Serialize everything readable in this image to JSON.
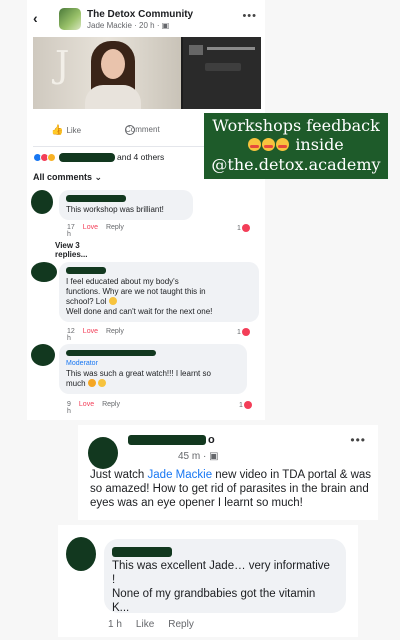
{
  "post": {
    "group_name": "The Detox Community",
    "author": "Jade Mackie",
    "time": "20 h",
    "more": "•••"
  },
  "icons": {
    "back": "‹",
    "like": "👍",
    "chevron": "⌄"
  },
  "actions": {
    "like": "Like",
    "comment": "Comment"
  },
  "reactions": {
    "others": "and 4 others"
  },
  "comments_header": "All comments",
  "comments": [
    {
      "text": "This workshop was brilliant!",
      "time": "17 h",
      "love": "Love",
      "reply": "Reply",
      "count": "1",
      "replies": "View 3 replies..."
    },
    {
      "line1": "I feel educated about my body's",
      "line2": "functions. Why are we not taught this in",
      "line3": "school? Lol",
      "line4": "Well done and can't wait for the next one!",
      "time": "12 h",
      "love": "Love",
      "reply": "Reply",
      "count": "1"
    },
    {
      "badge": "Moderator",
      "line1": "This was such a great watch!!! I learnt so",
      "line2": "much",
      "time": "9 h",
      "love": "Love",
      "reply": "Reply",
      "count": "1"
    }
  ],
  "overlay": {
    "line1": "Workshops feedback",
    "line2": "inside",
    "line3": "@the.detox.academy"
  },
  "post_comment": {
    "name_suffix": "o",
    "time": "45 m",
    "more": "•••",
    "text_before": "Just watch ",
    "mention": "Jade Mackie",
    "text_after": " new video in TDA portal & was so amazed! How to get rid of parasites in the brain and eyes was an eye opener I learnt so much!"
  },
  "bottom_comment": {
    "line1": "This was excellent Jade… very informative",
    "line2": "!",
    "line3": "None of my grandbabies got the vitamin",
    "line4": "K...",
    "time": "1 h",
    "like": "Like",
    "reply": "Reply"
  },
  "colors": {
    "facebook_blue": "#1877f2",
    "love_red": "#f33e58",
    "overlay_green": "#1e5b2a",
    "redaction": "#12381f"
  }
}
